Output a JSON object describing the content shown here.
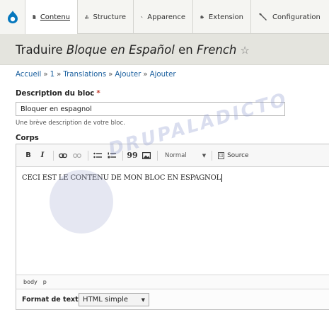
{
  "toolbar": {
    "items": [
      {
        "label": "Contenu",
        "icon": "file-icon"
      },
      {
        "label": "Structure",
        "icon": "structure-icon"
      },
      {
        "label": "Apparence",
        "icon": "brush-icon"
      },
      {
        "label": "Extension",
        "icon": "puzzle-icon"
      },
      {
        "label": "Configuration",
        "icon": "wrench-icon"
      }
    ]
  },
  "header": {
    "title_prefix": "Traduire",
    "title_item": "Bloque en Español",
    "title_mid": "en",
    "title_lang": "French",
    "star": "☆"
  },
  "breadcrumb": [
    "Accueil",
    "1",
    "Translations",
    "Ajouter",
    "Ajouter"
  ],
  "form": {
    "description_label": "Description du bloc",
    "required_mark": "*",
    "description_value": "Bloquer en espagnol",
    "description_help": "Une brève description de votre bloc.",
    "body_label": "Corps",
    "editor": {
      "bold": "B",
      "italic": "I",
      "blockquote": "99",
      "format_value": "Normal",
      "source_label": "Source",
      "content": "CECI EST LE CONTENU DE MON BLOC EN ESPAGNOL",
      "path": [
        "body",
        "p"
      ]
    },
    "text_format_label": "Format de texte",
    "text_format_value": "HTML simple"
  },
  "watermark": {
    "text": "DRUPALADICTO"
  },
  "colors": {
    "link": "#1a5f9e",
    "required": "#c0392b",
    "drupal_blue": "#0678be"
  }
}
